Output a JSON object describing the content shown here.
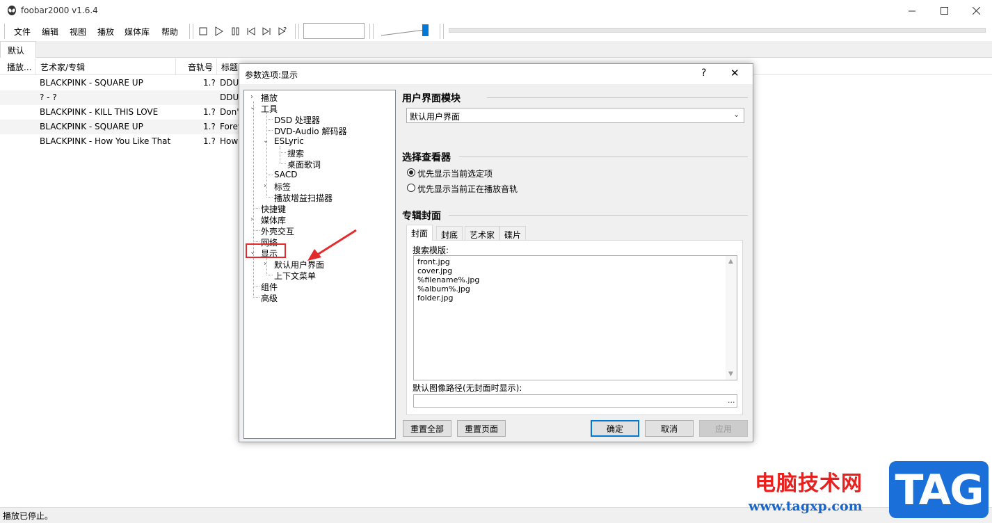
{
  "window": {
    "title": "foobar2000 v1.6.4"
  },
  "menu": [
    "文件",
    "编辑",
    "视图",
    "播放",
    "媒体库",
    "帮助"
  ],
  "playlist_tab": "默认",
  "columns": [
    "播放...",
    "艺术家/专辑",
    "音轨号",
    "标题"
  ],
  "playlist_rows": [
    {
      "artist": "BLACKPINK - SQUARE UP",
      "track": "1.?",
      "title": "DDU"
    },
    {
      "artist": "? - ?",
      "track": "",
      "title": "DDU"
    },
    {
      "artist": "BLACKPINK - KILL THIS LOVE",
      "track": "1.?",
      "title": "Don'"
    },
    {
      "artist": "BLACKPINK - SQUARE UP",
      "track": "1.?",
      "title": "Forev"
    },
    {
      "artist": "BLACKPINK - How You Like That",
      "track": "1.?",
      "title": "How"
    }
  ],
  "status": "播放已停止。",
  "dialog": {
    "title": "参数选项:显示",
    "help": "?",
    "close": "✕",
    "tree": {
      "playback": "播放",
      "tools": "工具",
      "dsd": "DSD 处理器",
      "dvd_audio": "DVD-Audio 解码器",
      "eslyric": "ESLyric",
      "search": "搜索",
      "desktop_lyrics": "桌面歌词",
      "sacd": "SACD",
      "tags": "标签",
      "replaygain": "播放增益扫描器",
      "shortcuts": "快捷键",
      "media_library": "媒体库",
      "shell": "外壳交互",
      "network": "网络",
      "display": "显示",
      "default_ui": "默认用户界面",
      "context_menu": "上下文菜单",
      "components": "组件",
      "advanced": "高级"
    },
    "ui_module": {
      "heading": "用户界面模块",
      "selected": "默认用户界面"
    },
    "viewer": {
      "heading": "选择查看器",
      "option1": "优先显示当前选定项",
      "option2": "优先显示当前正在播放音轨",
      "selected": 1
    },
    "album_art": {
      "heading": "专辑封面",
      "tabs": [
        "封面",
        "封底",
        "艺术家",
        "碟片"
      ],
      "active_tab": 0,
      "search_label": "搜索模版:",
      "search_patterns": [
        "front.jpg",
        "cover.jpg",
        "%filename%.jpg",
        "%album%.jpg",
        "folder.jpg"
      ],
      "default_path_label": "默认图像路径(无封面时显示):",
      "default_path_value": "",
      "browse": "..."
    },
    "buttons": {
      "reset_all": "重置全部",
      "reset_page": "重置页面",
      "ok": "确定",
      "cancel": "取消",
      "apply": "应用"
    }
  },
  "watermark": {
    "cn": "电脑技术网",
    "url": "www.tagxp.com",
    "badge": "TAG"
  },
  "colors": {
    "accent": "#0078d7",
    "annotation": "#e32b2b",
    "watermark_red": "#e8201e",
    "watermark_blue": "#1b6fd8"
  }
}
